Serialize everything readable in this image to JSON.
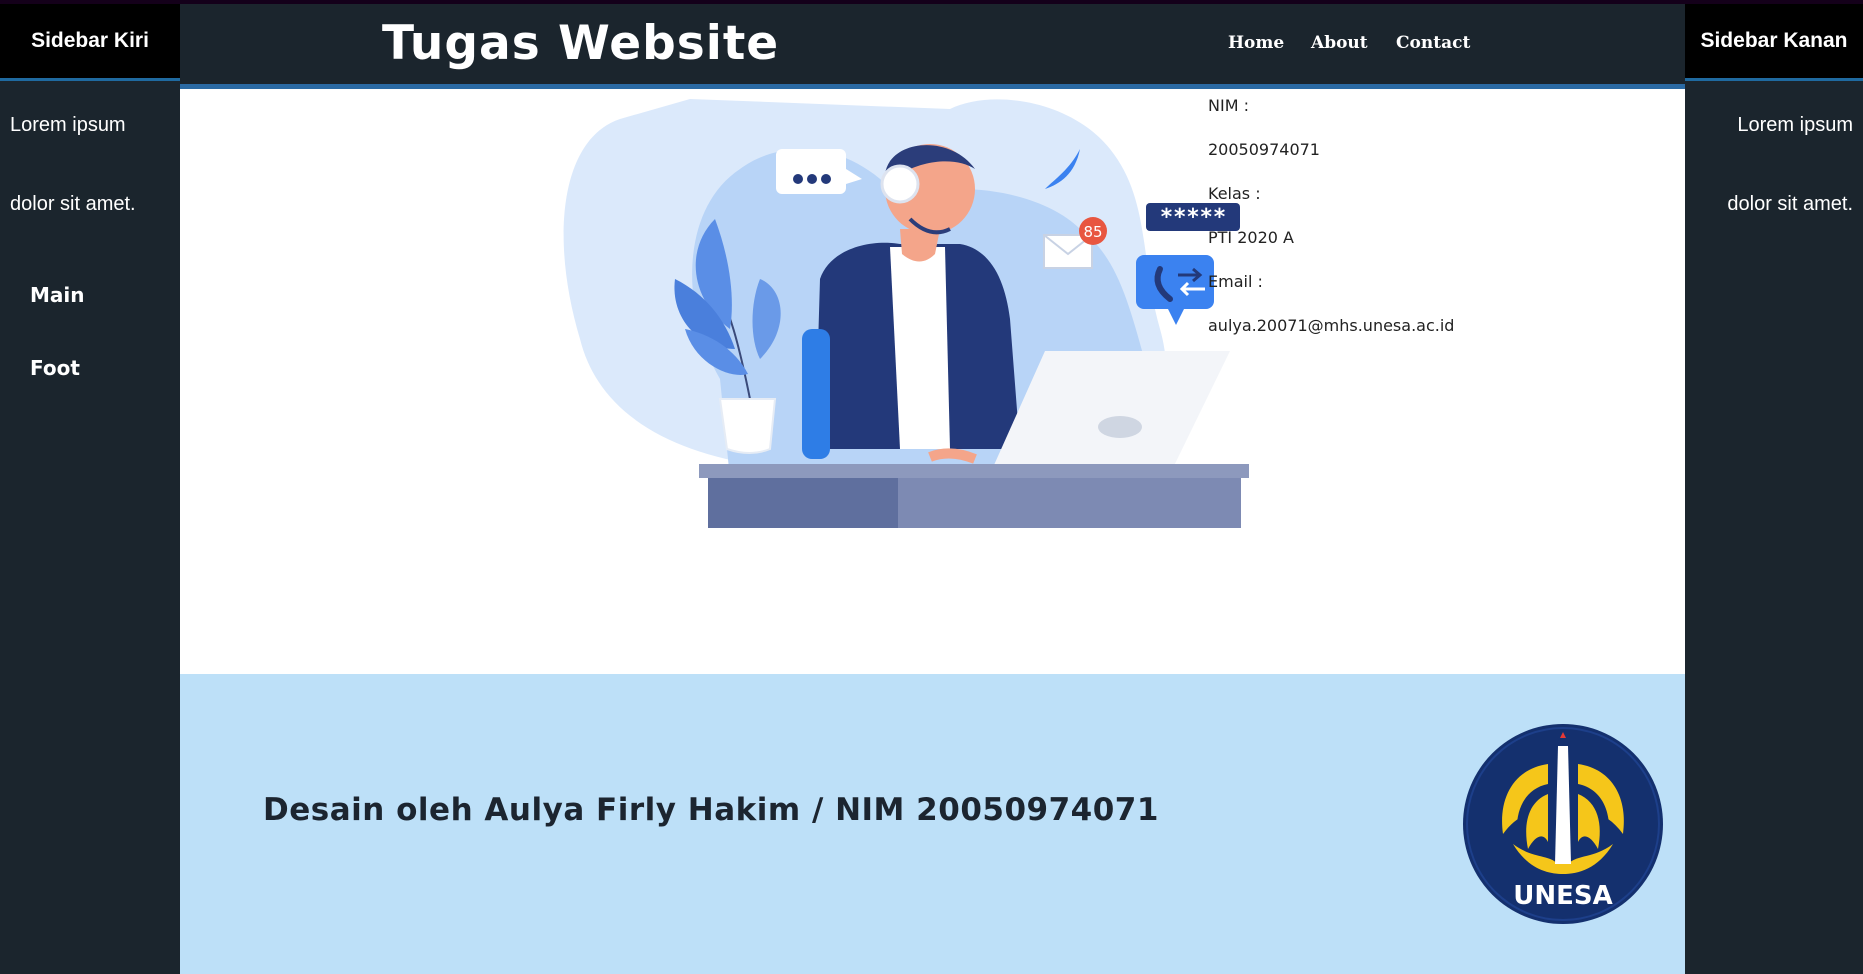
{
  "header": {
    "title": "Tugas Website",
    "nav": [
      "Home",
      "About",
      "Contact"
    ]
  },
  "sidebar_left": {
    "title": "Sidebar Kiri",
    "text_lines": [
      "Lorem ipsum",
      "dolor sit amet."
    ],
    "links": [
      "Main",
      "Foot"
    ]
  },
  "sidebar_right": {
    "title": "Sidebar Kanan",
    "text_lines": [
      "Lorem ipsum",
      "dolor sit amet."
    ]
  },
  "illustration": {
    "notification_count": "85",
    "password_mask": "*****"
  },
  "info": {
    "nim_label": "NIM :",
    "nim_value": "20050974071",
    "kelas_label": "Kelas :",
    "kelas_value": "PTI 2020 A",
    "email_label": "Email :",
    "email_value": "aulya.20071@mhs.unesa.ac.id"
  },
  "footer": {
    "credit": "Desain oleh Aulya Firly Hakim / NIM 20050974071",
    "logo_text": "UNESA"
  },
  "colors": {
    "sidebar_bg": "#1b252d",
    "header_bg": "#1b252d",
    "accent_border": "#2b6aa3",
    "footer_bg": "#bde0f8",
    "logo_navy": "#14306e",
    "logo_gold": "#f5c61a"
  }
}
